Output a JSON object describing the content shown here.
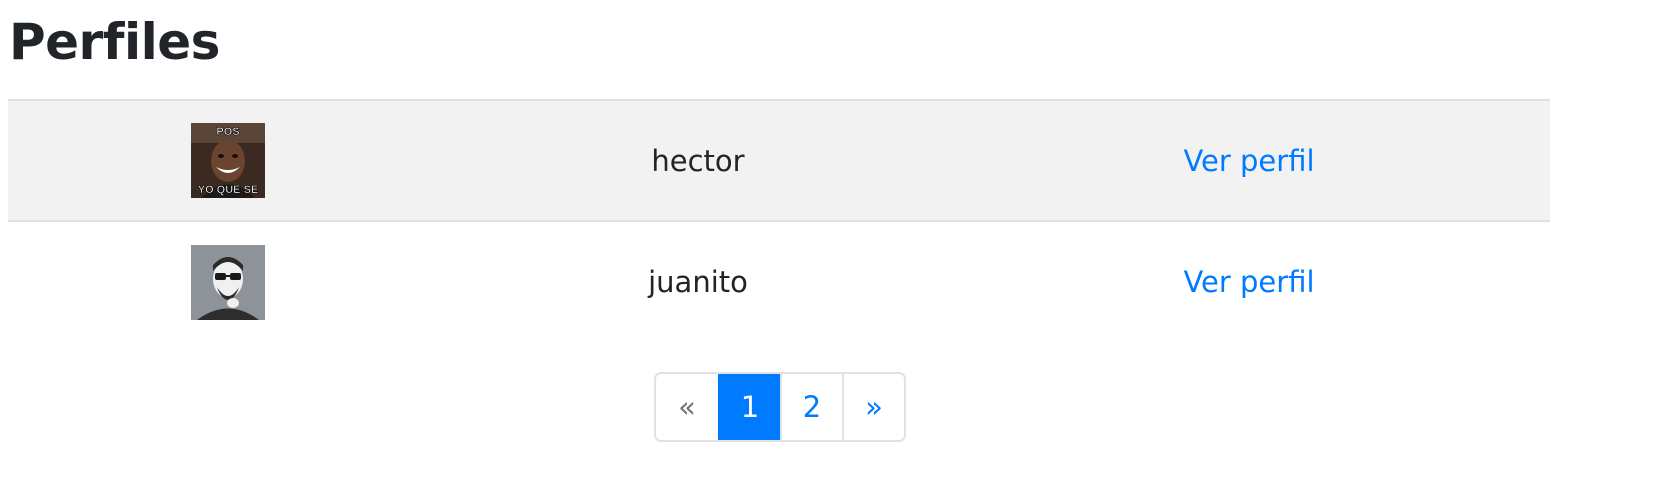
{
  "page": {
    "title": "Perfiles"
  },
  "profiles": [
    {
      "avatar": "avatar-meme-icon",
      "avatar_top_text": "POS",
      "avatar_bottom_text": "YO QUE SE",
      "username": "hector",
      "link_label": "Ver perfil"
    },
    {
      "avatar": "avatar-glasses-icon",
      "username": "juanito",
      "link_label": "Ver perfil"
    }
  ],
  "pagination": {
    "prev_label": "«",
    "pages": [
      "1",
      "2"
    ],
    "active_page": "1",
    "next_label": "»"
  },
  "colors": {
    "link": "#007bff",
    "active_page_bg": "#007bff",
    "striped_row_bg": "#f2f2f2",
    "border": "#dee2e6"
  }
}
